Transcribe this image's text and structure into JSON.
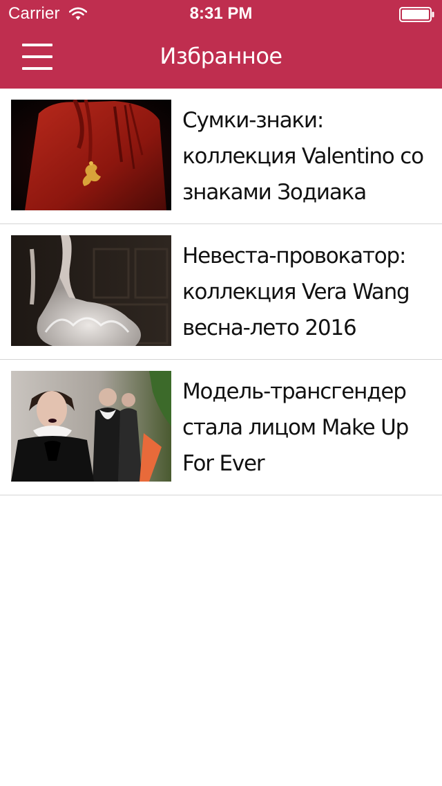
{
  "status_bar": {
    "carrier": "Carrier",
    "time": "8:31 PM",
    "wifi_icon": "wifi-icon",
    "battery_icon": "battery-full-icon"
  },
  "nav": {
    "title": "Избранное",
    "menu_icon": "hamburger-menu-icon",
    "background_color": "#bf2e4f"
  },
  "favorites": [
    {
      "title": "Сумки-знаки: коллекция Valentino со знаками Зодиака",
      "thumbnail": "red leather handbag with gold charm"
    },
    {
      "title": "Невеста-провокатор: коллекция Vera Wang весна-лето 2016",
      "thumbnail": "model in lace bridal gown with feathered skirt"
    },
    {
      "title": "Модель-трансгендер стала лицом Make Up For Ever",
      "thumbnail": "runway models in black outfits with white ruffled collars"
    }
  ]
}
